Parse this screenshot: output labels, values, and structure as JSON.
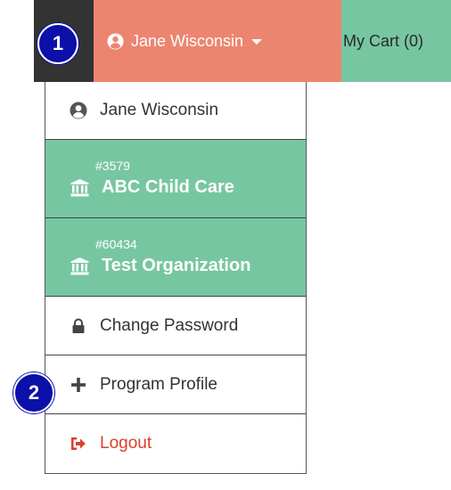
{
  "navbar": {
    "user_name": "Jane Wisconsin",
    "cart_label": "My Cart (0)"
  },
  "dropdown": {
    "user_name": "Jane Wisconsin",
    "organizations": [
      {
        "id": "#3579",
        "name": "ABC Child Care"
      },
      {
        "id": "#60434",
        "name": "Test Organization"
      }
    ],
    "change_password_label": "Change Password",
    "program_profile_label": "Program Profile",
    "logout_label": "Logout"
  },
  "callouts": [
    "1",
    "2"
  ],
  "colors": {
    "user_segment": "#ec8570",
    "cart_segment": "#77c6a2",
    "org_item": "#77c6a2",
    "dark_segment": "#333333",
    "logout_text": "#d9412b",
    "callout_badge": "#0b10a8"
  },
  "icons": {
    "user": "user-circle-icon",
    "caret": "caret-down-icon",
    "cart": "shopping-cart-icon",
    "organization": "institution-icon",
    "lock": "lock-icon",
    "plus": "plus-icon",
    "logout": "sign-out-icon"
  }
}
